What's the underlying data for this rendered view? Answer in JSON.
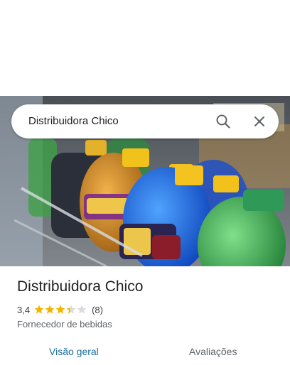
{
  "search": {
    "value": "Distribuidora Chico"
  },
  "icons": {
    "search": "search-icon",
    "close": "close-icon",
    "star": "star-icon"
  },
  "place": {
    "name": "Distribuidora Chico",
    "rating": "3,4",
    "rating_value": 3.4,
    "stars_max": 5,
    "review_count": "(8)",
    "category": "Fornecedor de bebidas"
  },
  "tabs": [
    {
      "label": "Visão geral",
      "selected": true
    },
    {
      "label": "Avaliações",
      "selected": false
    }
  ],
  "colors": {
    "accent": "#1b6e99",
    "star": "#f4b400",
    "star_empty": "#dadce0"
  }
}
